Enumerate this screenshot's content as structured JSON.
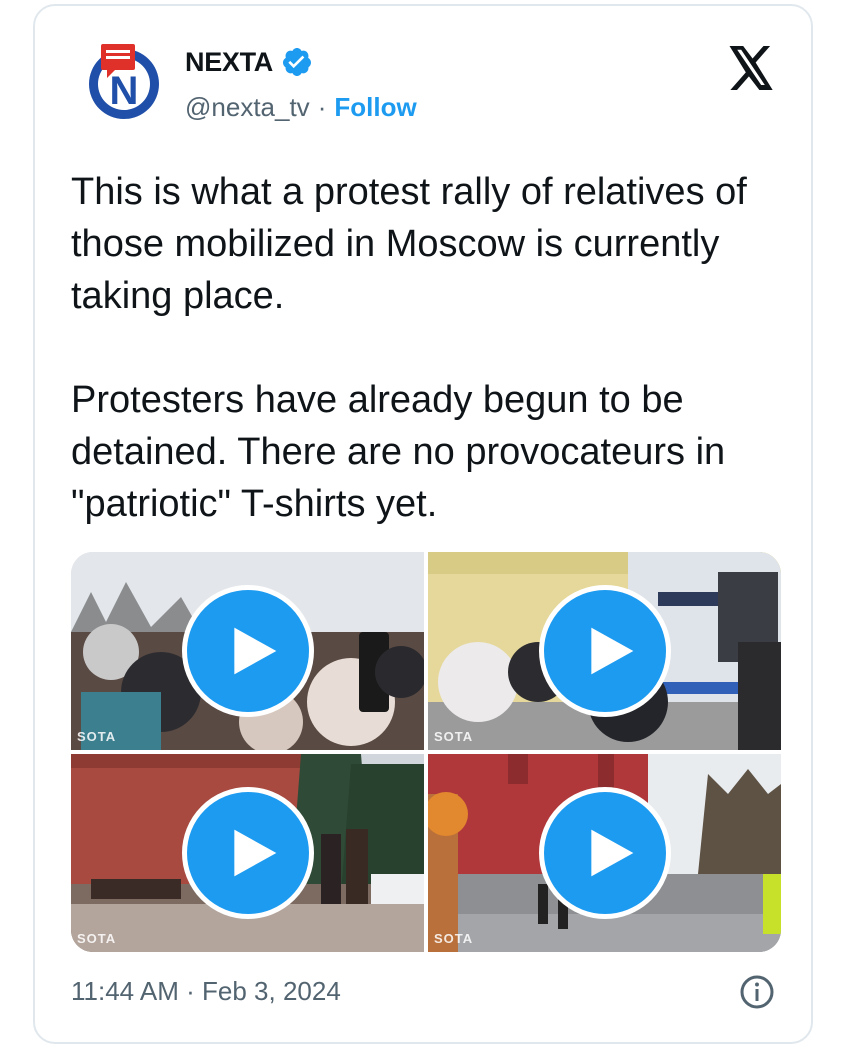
{
  "account": {
    "name": "NEXTA",
    "handle": "@nexta_tv",
    "separator": "·",
    "follow_label": "Follow",
    "avatar_letter": "N"
  },
  "tweet": {
    "paragraphs": [
      "This is what a protest rally of relatives of those mobilized in Moscow is currently taking place.",
      "Protesters have already begun to be detained. There are no provocateurs in \"patriotic\" T-shirts yet."
    ],
    "timestamp": "11:44 AM · Feb 3, 2024"
  },
  "media": {
    "videos": [
      {
        "watermark": "SOTA"
      },
      {
        "watermark": "SOTA"
      },
      {
        "watermark": "SOTA"
      },
      {
        "watermark": "SOTA"
      }
    ]
  },
  "colors": {
    "accent": "#1d9bf0",
    "text": "#0f1419",
    "secondary": "#536471",
    "avatar_red": "#e0302a",
    "avatar_blue": "#1f4fa8"
  },
  "icons": {
    "platform": "x-logo-icon",
    "verified": "verified-badge-icon",
    "play": "play-icon",
    "info": "info-icon"
  }
}
